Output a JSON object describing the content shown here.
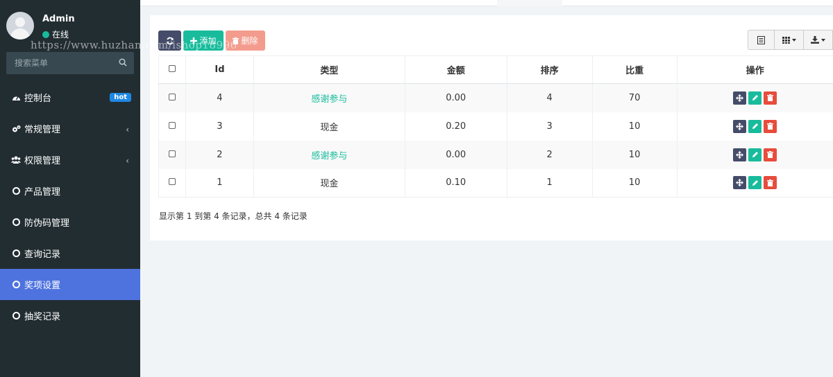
{
  "user": {
    "name": "Admin",
    "status": "在线"
  },
  "watermark": "https://www.huzhan.com/ishop18996",
  "search": {
    "placeholder": "搜索菜单"
  },
  "menu": [
    {
      "label": "控制台",
      "icon": "dashboard-icon",
      "badge": "hot"
    },
    {
      "label": "常规管理",
      "icon": "cogs-icon",
      "chevron": "‹"
    },
    {
      "label": "权限管理",
      "icon": "users-icon",
      "chevron": "‹"
    },
    {
      "label": "产品管理",
      "icon": "circle-icon"
    },
    {
      "label": "防伪码管理",
      "icon": "circle-icon"
    },
    {
      "label": "查询记录",
      "icon": "circle-icon"
    },
    {
      "label": "奖项设置",
      "icon": "circle-icon",
      "active": true
    },
    {
      "label": "抽奖记录",
      "icon": "circle-icon"
    }
  ],
  "toolbar": {
    "refresh_icon": "refresh-icon",
    "add_label": "添加",
    "delete_label": "删除"
  },
  "table": {
    "headers": [
      "Id",
      "类型",
      "金额",
      "排序",
      "比重",
      "操作"
    ],
    "rows": [
      {
        "id": "4",
        "type": "感谢参与",
        "amount": "0.00",
        "sort": "4",
        "weight": "70"
      },
      {
        "id": "3",
        "type": "现金",
        "amount": "0.20",
        "sort": "3",
        "weight": "10"
      },
      {
        "id": "2",
        "type": "感谢参与",
        "amount": "0.00",
        "sort": "2",
        "weight": "10"
      },
      {
        "id": "1",
        "type": "现金",
        "amount": "0.10",
        "sort": "1",
        "weight": "10"
      }
    ]
  },
  "pagination": {
    "info": "显示第 1 到第 4 条记录，总共 4 条记录"
  },
  "colors": {
    "sidebar": "#222d32",
    "active": "#4e73df",
    "success": "#18bc9c",
    "danger": "#e74c3c",
    "primary_dark": "#444c69"
  }
}
